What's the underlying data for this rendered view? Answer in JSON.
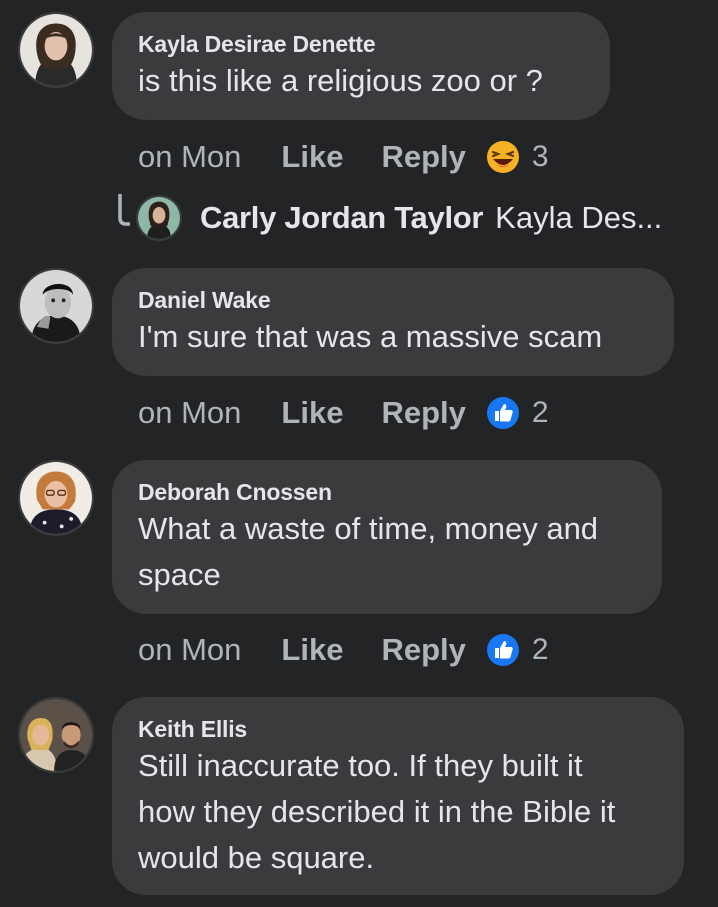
{
  "comments": [
    {
      "author": "Kayla Desirae Denette",
      "text": "is this like a religious zoo or ?",
      "time": "on Mon",
      "like_label": "Like",
      "reply_label": "Reply",
      "reaction_icon": "haha-reaction-icon",
      "reaction_count": "3",
      "reply_preview": {
        "name": "Carly Jordan Taylor",
        "snippet": "Kayla Des..."
      }
    },
    {
      "author": "Daniel Wake",
      "text": "I'm sure that was a massive scam",
      "time": "on Mon",
      "like_label": "Like",
      "reply_label": "Reply",
      "reaction_icon": "like-reaction-icon",
      "reaction_count": "2"
    },
    {
      "author": "Deborah Cnossen",
      "text_lines": [
        "What a waste of time, money and",
        "space"
      ],
      "time": "on Mon",
      "like_label": "Like",
      "reply_label": "Reply",
      "reaction_icon": "like-reaction-icon",
      "reaction_count": "2"
    },
    {
      "author": "Keith Ellis",
      "text_lines": [
        "Still inaccurate too. If they built it",
        "how they described it in the Bible it",
        "would be square."
      ]
    }
  ],
  "colors": {
    "background": "#232425",
    "bubble": "#3a3b3c",
    "primary_text": "#e4e6eb",
    "secondary_text": "#b0b3b8",
    "like_blue": "#1877f2",
    "haha_yellow": "#f7b125"
  }
}
